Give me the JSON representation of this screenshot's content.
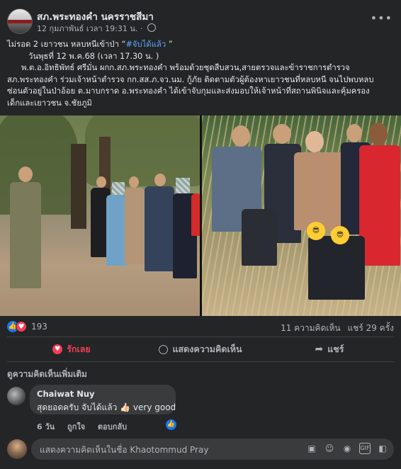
{
  "post": {
    "page_name": "สภ.พระทองคำ นครราชสีมา",
    "timestamp": "12 กุมภาพันธ์ เวลา 19:31 น. ·",
    "body": {
      "line1_prefix": "ไม่รอด 2 เยาวชน หลบหนีเข้าป่า “",
      "hashtag": "#จับได้แล้ว",
      "line1_suffix": " ”",
      "line2": "วันพุธที่ 12 พ.ค.68 (เวลา 17.30 น. )",
      "line3": "พ.ต.อ.อิทธิพัทธ์ ศรีมั่น ผกก.สภ.พระทองคำ พร้อมด้วยชุดสืบสวน,สายตรวจและข้าราชการตำรวจ",
      "line4": "สภ.พระทองคำ ร่วมเจ้าหน้าตำรวจ กก.สส.ภ.จว.นม. กู้ภัย ติดตามตัวผู้ต้องหาเยาวชนที่หลบหนี จนไปพบหลบ",
      "line5": "ซ่อนตัวอยู่ในป่าอ้อย ต.มาบกราด อ.พระทองคำ ได้เข้าจับกุมและส่งมอบให้เจ้าหน้าที่สถานพินิจและคุ้มครอง",
      "line6": "เด็กและเยาวชน จ.ชัยภูมิ"
    },
    "photos": {
      "emoji_left": "😎",
      "emoji_right": "😎"
    },
    "stats": {
      "reaction_count": "193",
      "comments": "11 ความคิดเห็น",
      "shares": "แชร์ 29 ครั้ง"
    },
    "actions": {
      "love_label": "รักเลย",
      "comment_label": "แสดงความคิดเห็น",
      "share_label": "แชร์"
    }
  },
  "comments": {
    "more_label": "ดูความคิดเห็นเพิ่มเติม",
    "items": [
      {
        "author": "Chaiwat Nuy",
        "text": "สุดยอดครับ จับได้แล้ว 👍🏻 very good",
        "time": "6 วัน",
        "like_label": "ถูกใจ",
        "reply_label": "ตอบกลับ"
      }
    ]
  },
  "composer": {
    "placeholder": "แสดงความคิดเห็นในชื่อ Khaotommud Pray"
  },
  "icons": {
    "more": "more-horizontal-icon",
    "globe": "globe-icon",
    "like": "like-reaction-icon",
    "love": "love-reaction-icon",
    "comment": "comment-icon",
    "share": "share-icon"
  },
  "colors": {
    "card_bg": "#242526",
    "text": "#e4e6eb",
    "muted": "#b0b3b8",
    "accent_blue": "#1877f2",
    "love_red": "#f33e58",
    "hashtag": "#5aa7ff"
  }
}
